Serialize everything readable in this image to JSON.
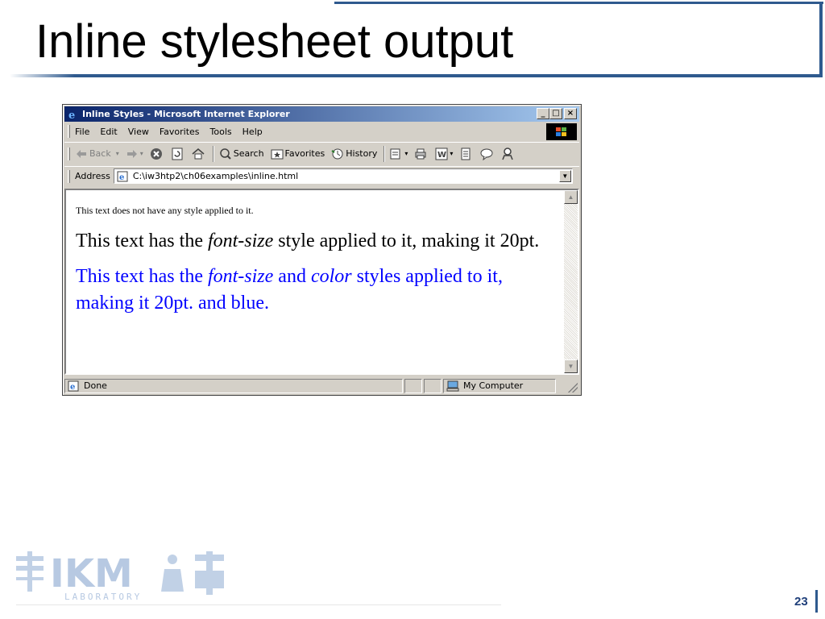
{
  "slide": {
    "title": "Inline stylesheet output",
    "page_number": "23"
  },
  "window": {
    "title": "Inline Styles - Microsoft Internet Explorer",
    "buttons": {
      "minimize": "_",
      "maximize": "□",
      "close": "×"
    }
  },
  "menu": [
    "File",
    "Edit",
    "View",
    "Favorites",
    "Tools",
    "Help"
  ],
  "toolbar": {
    "back": "Back",
    "search": "Search",
    "favorites": "Favorites",
    "history": "History"
  },
  "address": {
    "label": "Address",
    "value": "C:\\iw3htp2\\ch06examples\\inline.html"
  },
  "page": {
    "paragraph1": "This text does not have any style applied to it.",
    "p2_part1": "This text has the ",
    "p2_em": "font-size",
    "p2_part2": " style applied to it, making it 20pt.",
    "p3_part1": "This text has the ",
    "p3_em1": "font-size",
    "p3_part2": " and ",
    "p3_em2": "color",
    "p3_part3": " styles applied to it, making it 20pt. and blue.",
    "p3_color": "#0000ff"
  },
  "status": {
    "text": "Done",
    "zone": "My Computer"
  },
  "colors": {
    "accent": "#2f5a8e",
    "titlebar_start": "#0a246a",
    "titlebar_end": "#a6caf0"
  },
  "logo": {
    "text": "IKM",
    "subtext": "LABORATORY"
  }
}
